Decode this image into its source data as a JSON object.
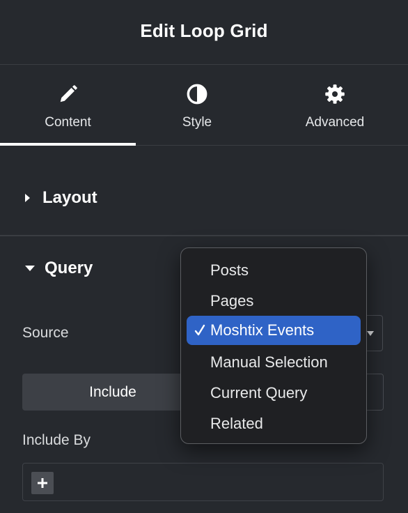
{
  "header": {
    "title": "Edit Loop Grid"
  },
  "tabs": [
    {
      "label": "Content",
      "icon": "pencil-icon",
      "active": true
    },
    {
      "label": "Style",
      "icon": "half-circle-contrast-icon",
      "active": false
    },
    {
      "label": "Advanced",
      "icon": "gear-icon",
      "active": false
    }
  ],
  "sections": {
    "layout": {
      "title": "Layout",
      "expanded": false
    },
    "query": {
      "title": "Query",
      "expanded": true
    }
  },
  "query": {
    "source_label": "Source",
    "source_value": "Moshtix Events",
    "include_tab_label": "Include",
    "include_by_label": "Include By"
  },
  "source_dropdown": {
    "open": true,
    "items": [
      {
        "label": "Posts",
        "selected": false
      },
      {
        "label": "Pages",
        "selected": false
      },
      {
        "label": "Moshtix Events",
        "selected": true
      },
      {
        "label": "Manual Selection",
        "selected": false
      },
      {
        "label": "Current Query",
        "selected": false
      },
      {
        "label": "Related",
        "selected": false
      }
    ]
  },
  "colors": {
    "panel_bg": "#26292e",
    "menu_bg": "#1f2023",
    "selection_blue": "#2f63c6",
    "divider": "#3a3d42"
  }
}
